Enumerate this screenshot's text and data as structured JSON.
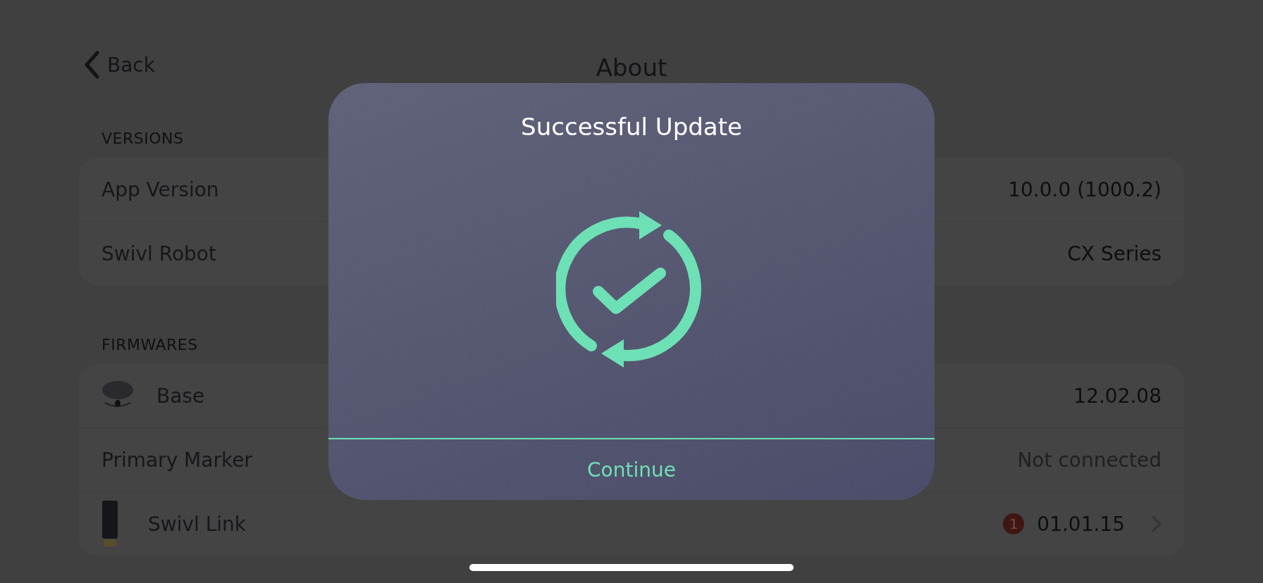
{
  "header": {
    "back": "Back",
    "title": "About"
  },
  "sections": [
    {
      "heading": "VERSIONS",
      "rows": [
        {
          "kind": "plain",
          "label": "App Version",
          "value": "10.0.0 (1000.2)",
          "greyed": false
        },
        {
          "kind": "plain",
          "label": "Swivl Robot",
          "value": "CX Series",
          "greyed": false
        }
      ]
    },
    {
      "heading": "FIRMWARES",
      "rows": [
        {
          "kind": "base",
          "label": "Base",
          "value": "12.02.08",
          "greyed": false
        },
        {
          "kind": "plain",
          "label": "Primary Marker",
          "value": "Not connected",
          "greyed": true
        },
        {
          "kind": "link",
          "label": "Swivl Link",
          "value": "01.01.15",
          "greyed": false,
          "badge": "1",
          "chevron": true
        }
      ]
    }
  ],
  "dialog": {
    "title": "Successful Update",
    "button": "Continue"
  }
}
